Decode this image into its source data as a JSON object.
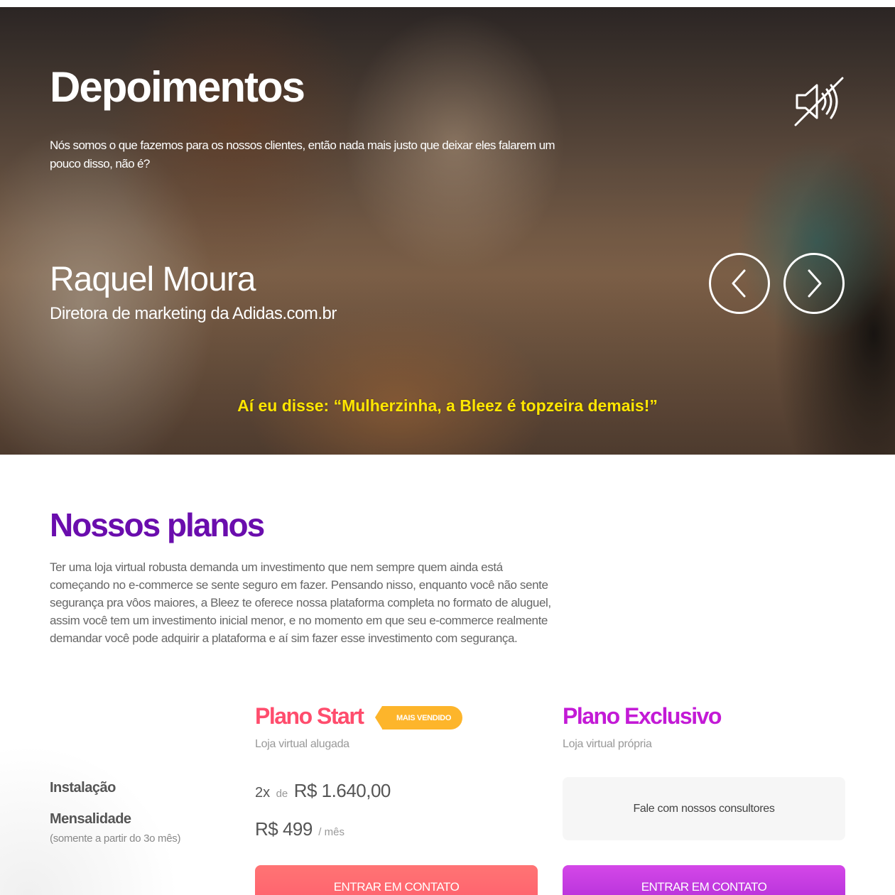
{
  "testimonials": {
    "title": "Depoimentos",
    "subtitle": "Nós somos o que fazemos para os nossos clientes, então nada mais justo que deixar eles falarem um pouco disso, não é?",
    "person_name": "Raquel Moura",
    "person_role": "Diretora de marketing da Adidas.com.br",
    "quote": "Aí eu disse: “Mulherzinha, a Bleez é topzeira demais!”",
    "mute_icon": "sound-muted-icon",
    "prev_icon": "chevron-left-icon",
    "next_icon": "chevron-right-icon",
    "quote_color": "#ffe600"
  },
  "plans": {
    "title": "Nossos planos",
    "description": "Ter uma loja virtual robusta demanda um investimento que nem sempre quem ainda está começando no e-commerce se sente seguro em fazer. Pensando nisso, enquanto você não sente segurança pra vôos maiores, a Bleez te oferece nossa plataforma completa no formato de aluguel, assim você tem um investimento inicial menor, e no momento em que seu e-commerce realmente demandar você pode adquirir a plataforma e aí sim fazer esse investimento com segurança.",
    "title_color": "#6a0dad",
    "rows": {
      "installation_label": "Instalação",
      "monthly_label": "Mensalidade",
      "monthly_note": "(somente a partir do 3o mês)"
    },
    "start": {
      "name": "Plano Start",
      "subtitle": "Loja virtual alugada",
      "badge": "MAIS VENDIDO",
      "install_installments": "2x",
      "install_of": "de",
      "install_price": "R$ 1.640,00",
      "monthly_price": "R$ 499",
      "monthly_suffix": "/ mês",
      "cta": "ENTRAR EM CONTATO",
      "color": "#ff4d6d"
    },
    "exclusive": {
      "name": "Plano Exclusivo",
      "subtitle": "Loja virtual própria",
      "consult_text": "Fale com nossos consultores",
      "cta": "ENTRAR EM CONTATO",
      "color": "#c31ad6"
    }
  }
}
